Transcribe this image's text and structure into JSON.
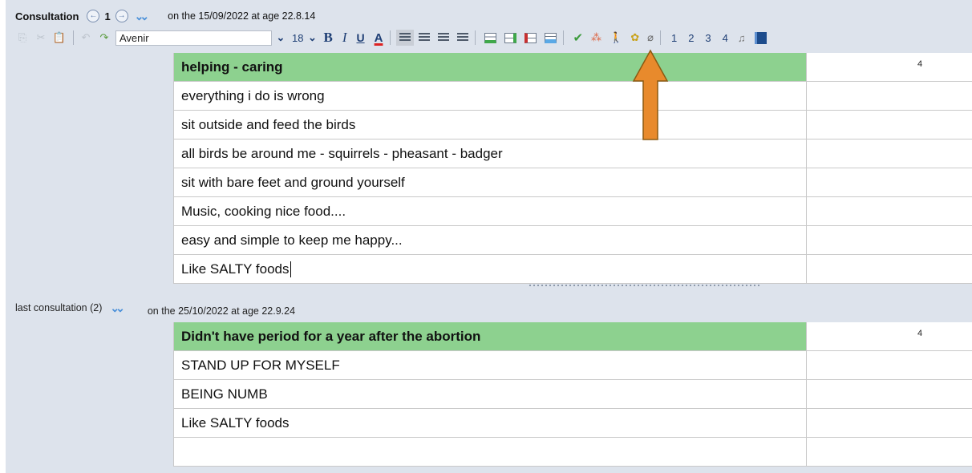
{
  "consultation": {
    "title": "Consultation",
    "prev_icon": "arrow-left-circle-icon",
    "next_icon": "arrow-right-circle-icon",
    "number": "1",
    "expand_icon": "double-chevron-down-icon",
    "meta": "on the 15/09/2022 at age 22.8.14"
  },
  "toolbar": {
    "font_name": "Avenir",
    "font_size": "18",
    "bold": "B",
    "italic": "I",
    "underline": "U",
    "color": "A",
    "levels": [
      "1",
      "2",
      "3",
      "4"
    ]
  },
  "table1": {
    "header": "helping - caring",
    "header_count": "4",
    "rows": [
      "everything i do is wrong",
      "sit outside and feed the birds",
      "all birds be around me - squirrels - pheasant - badger",
      "sit with bare feet and ground yourself",
      "Music, cooking nice food....",
      "easy and simple to keep me happy...",
      "Like SALTY foods"
    ]
  },
  "last_consultation": {
    "title": "last consultation (2)",
    "meta": "on the 25/10/2022 at age 22.9.24"
  },
  "table2": {
    "header": "Didn't have period for a year after the abortion",
    "header_count": "4",
    "rows": [
      "STAND UP FOR MYSELF",
      "BEING NUMB",
      "Like SALTY foods",
      ""
    ]
  },
  "colors": {
    "header_row": "#8dd18f",
    "panel": "#dde3ec",
    "arrow_fill": "#e88a2c",
    "accent": "#4a90d9"
  }
}
